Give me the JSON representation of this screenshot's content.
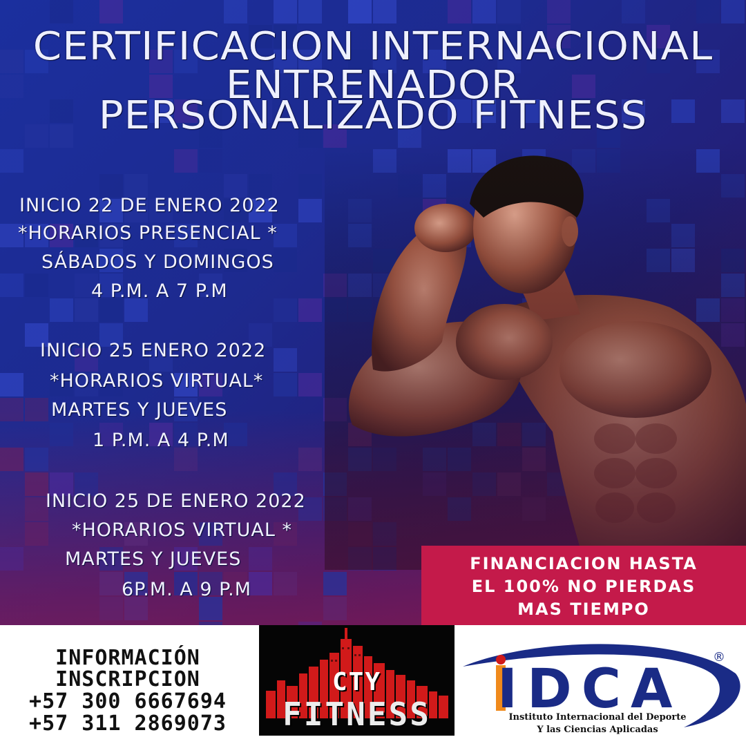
{
  "title": {
    "line1": "CERTIFICACION INTERNACIONAL",
    "line2": "ENTRENADOR",
    "line3": "PERSONALIZADO FITNESS"
  },
  "schedules": [
    {
      "start": "INICIO 22 DE ENERO 2022",
      "mode": "*HORARIOS PRESENCIAL *",
      "days": "SÁBADOS Y DOMINGOS",
      "hours": "4 P.M. A 7 P.M"
    },
    {
      "start": "INICIO 25 ENERO 2022",
      "mode": "*HORARIOS VIRTUAL*",
      "days": "MARTES Y JUEVES",
      "hours": "1 P.M. A 4 P.M"
    },
    {
      "start": "INICIO 25 DE ENERO 2022",
      "mode": "*HORARIOS VIRTUAL *",
      "days": "MARTES Y JUEVES",
      "hours": "6P.M. A 9 P.M"
    }
  ],
  "promo": {
    "line1": "FINANCIACION HASTA",
    "line2": "EL 100% NO PIERDAS",
    "line3": "MAS TIEMPO"
  },
  "contact": {
    "line1": "INFORMACIÓN",
    "line2": "INSCRIPCION",
    "phone1": "+57 300 6667694",
    "phone2": "+57 311 2869073"
  },
  "logos": {
    "city_fitness": {
      "top": "CTY",
      "bottom": "FITNESS"
    },
    "idca": {
      "letters": "IDCA",
      "registered": "®",
      "sub1": "Instituto Internacional del Deporte",
      "sub2": "Y las Ciencias Aplicadas"
    }
  },
  "colors": {
    "background_blue": "#1b2f9e",
    "promo_red": "#c41a4a",
    "idca_blue": "#1a2b86",
    "idca_orange": "#f08a1c",
    "city_red": "#d11a1a"
  }
}
